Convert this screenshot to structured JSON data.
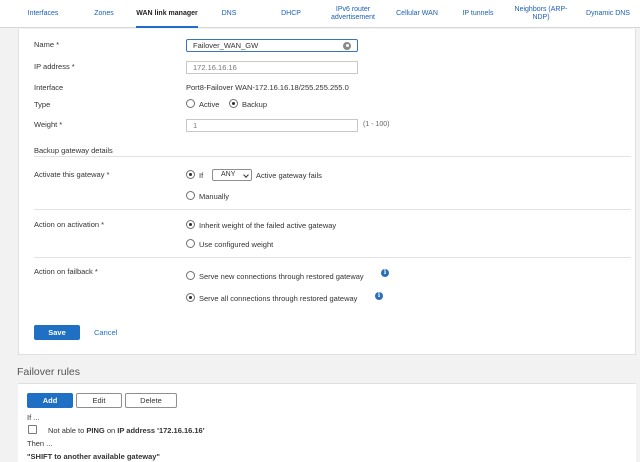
{
  "tabs": [
    {
      "label": "Interfaces"
    },
    {
      "label": "Zones"
    },
    {
      "label": "WAN link manager"
    },
    {
      "label": "DNS"
    },
    {
      "label": "DHCP"
    },
    {
      "label": "IPv6 router advertisement"
    },
    {
      "label": "Cellular WAN"
    },
    {
      "label": "IP tunnels"
    },
    {
      "label": "Neighbors (ARP-NDP)"
    },
    {
      "label": "Dynamic DNS"
    }
  ],
  "form": {
    "name_label": "Name *",
    "name_value": "Failover_WAN_GW",
    "ip_label": "IP address *",
    "ip_value": "172.16.16.16",
    "interface_label": "Interface",
    "interface_value": "Port8-Failover WAN-172.16.16.18/255.255.255.0",
    "type_label": "Type",
    "type_active": "Active",
    "type_backup": "Backup",
    "weight_label": "Weight *",
    "weight_value": "1",
    "weight_range": "(1 - 100)",
    "section_title": "Backup gateway details",
    "activate_label": "Activate this gateway *",
    "activate_if": "If",
    "activate_select": "ANY",
    "activate_suffix": "Active gateway fails",
    "activate_manually": "Manually",
    "action_activation_label": "Action on activation *",
    "inherit_weight": "Inherit weight of the failed active gateway",
    "use_configured": "Use configured weight",
    "action_failback_label": "Action on failback *",
    "serve_new": "Serve new connections through restored gateway",
    "serve_all": "Serve all connections through restored gateway",
    "save": "Save",
    "cancel": "Cancel"
  },
  "rules": {
    "title": "Failover rules",
    "add": "Add",
    "edit": "Edit",
    "delete": "Delete",
    "if_text": "If ...",
    "cond_prefix": "Not able to",
    "cond_ping": "PING",
    "cond_on": "on",
    "cond_ip_label": "IP address",
    "cond_ip": "'172.16.16.16'",
    "then_text": "Then ...",
    "then_action": "\"SHIFT to another available gateway\""
  }
}
